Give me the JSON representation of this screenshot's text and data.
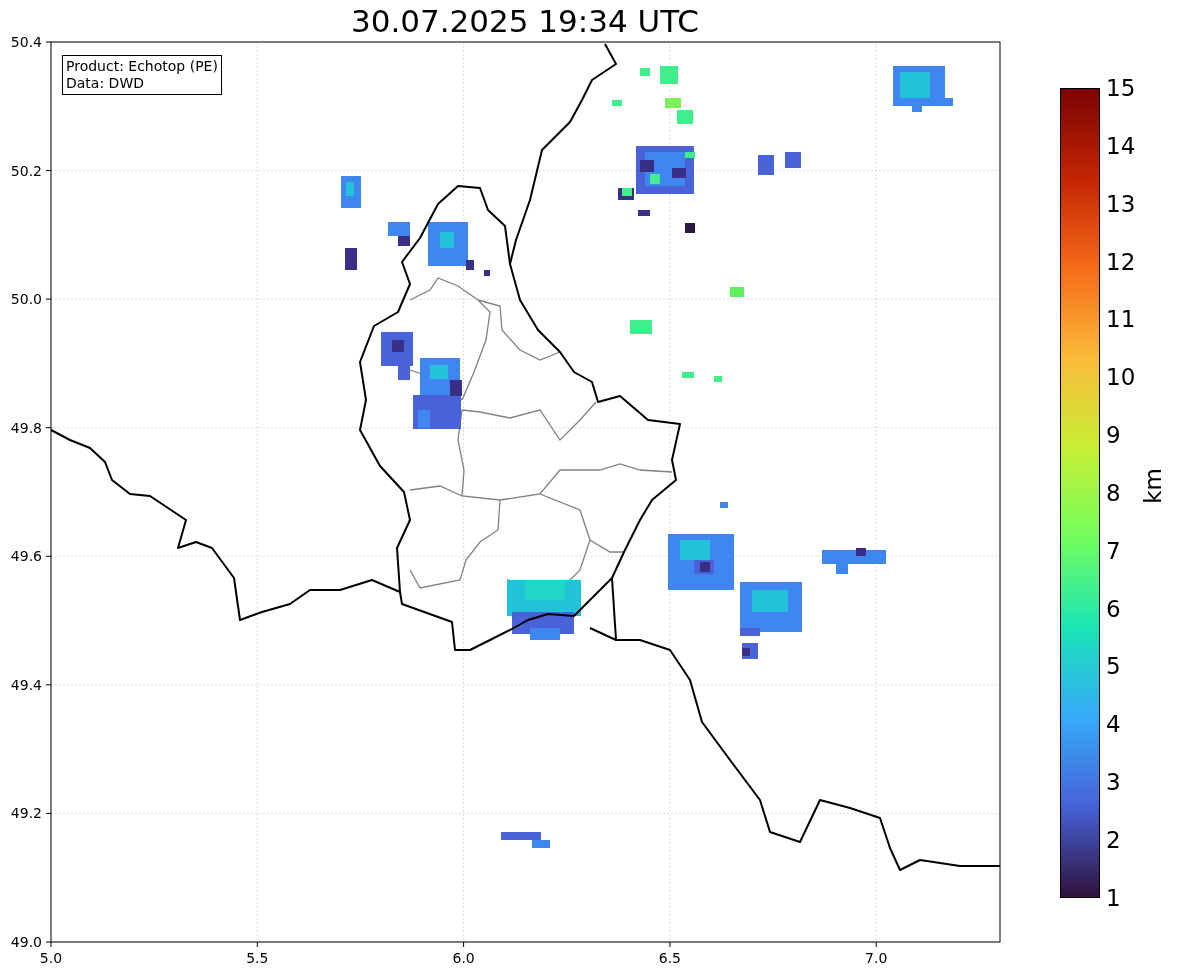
{
  "title": "30.07.2025 19:34 UTC",
  "info_box": {
    "lines": [
      "Product: Echotop (PE)",
      "Data: DWD"
    ]
  },
  "map": {
    "x_ticks": [
      "5.0",
      "5.5",
      "6.0",
      "6.5",
      "7.0"
    ],
    "y_ticks": [
      "50.4",
      "50.2",
      "50.0",
      "49.8",
      "49.6",
      "49.4",
      "49.2",
      "49.0"
    ]
  },
  "colorbar": {
    "label": "km",
    "ticks": [
      "15",
      "14",
      "13",
      "12",
      "11",
      "10",
      "9",
      "8",
      "7",
      "6",
      "5",
      "4",
      "3",
      "2",
      "1"
    ]
  }
}
